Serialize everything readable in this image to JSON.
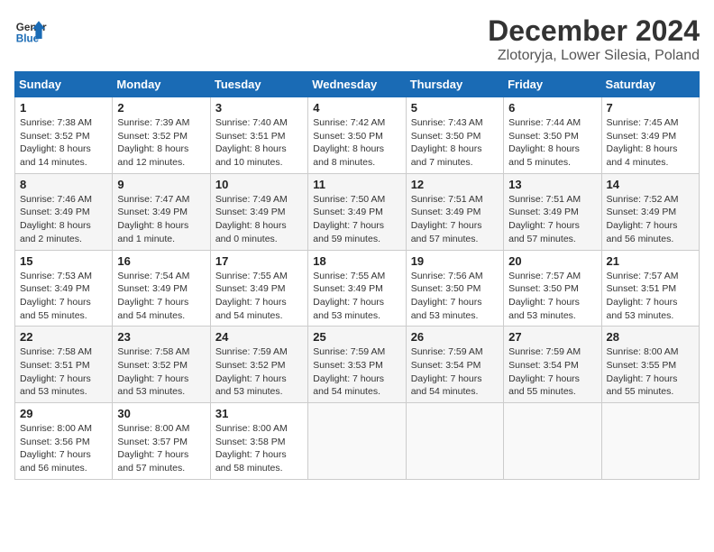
{
  "header": {
    "logo_line1": "General",
    "logo_line2": "Blue",
    "title": "December 2024",
    "subtitle": "Zlotoryja, Lower Silesia, Poland"
  },
  "calendar": {
    "days_of_week": [
      "Sunday",
      "Monday",
      "Tuesday",
      "Wednesday",
      "Thursday",
      "Friday",
      "Saturday"
    ],
    "weeks": [
      [
        {
          "day": "1",
          "info": "Sunrise: 7:38 AM\nSunset: 3:52 PM\nDaylight: 8 hours\nand 14 minutes."
        },
        {
          "day": "2",
          "info": "Sunrise: 7:39 AM\nSunset: 3:52 PM\nDaylight: 8 hours\nand 12 minutes."
        },
        {
          "day": "3",
          "info": "Sunrise: 7:40 AM\nSunset: 3:51 PM\nDaylight: 8 hours\nand 10 minutes."
        },
        {
          "day": "4",
          "info": "Sunrise: 7:42 AM\nSunset: 3:50 PM\nDaylight: 8 hours\nand 8 minutes."
        },
        {
          "day": "5",
          "info": "Sunrise: 7:43 AM\nSunset: 3:50 PM\nDaylight: 8 hours\nand 7 minutes."
        },
        {
          "day": "6",
          "info": "Sunrise: 7:44 AM\nSunset: 3:50 PM\nDaylight: 8 hours\nand 5 minutes."
        },
        {
          "day": "7",
          "info": "Sunrise: 7:45 AM\nSunset: 3:49 PM\nDaylight: 8 hours\nand 4 minutes."
        }
      ],
      [
        {
          "day": "8",
          "info": "Sunrise: 7:46 AM\nSunset: 3:49 PM\nDaylight: 8 hours\nand 2 minutes."
        },
        {
          "day": "9",
          "info": "Sunrise: 7:47 AM\nSunset: 3:49 PM\nDaylight: 8 hours\nand 1 minute."
        },
        {
          "day": "10",
          "info": "Sunrise: 7:49 AM\nSunset: 3:49 PM\nDaylight: 8 hours\nand 0 minutes."
        },
        {
          "day": "11",
          "info": "Sunrise: 7:50 AM\nSunset: 3:49 PM\nDaylight: 7 hours\nand 59 minutes."
        },
        {
          "day": "12",
          "info": "Sunrise: 7:51 AM\nSunset: 3:49 PM\nDaylight: 7 hours\nand 57 minutes."
        },
        {
          "day": "13",
          "info": "Sunrise: 7:51 AM\nSunset: 3:49 PM\nDaylight: 7 hours\nand 57 minutes."
        },
        {
          "day": "14",
          "info": "Sunrise: 7:52 AM\nSunset: 3:49 PM\nDaylight: 7 hours\nand 56 minutes."
        }
      ],
      [
        {
          "day": "15",
          "info": "Sunrise: 7:53 AM\nSunset: 3:49 PM\nDaylight: 7 hours\nand 55 minutes."
        },
        {
          "day": "16",
          "info": "Sunrise: 7:54 AM\nSunset: 3:49 PM\nDaylight: 7 hours\nand 54 minutes."
        },
        {
          "day": "17",
          "info": "Sunrise: 7:55 AM\nSunset: 3:49 PM\nDaylight: 7 hours\nand 54 minutes."
        },
        {
          "day": "18",
          "info": "Sunrise: 7:55 AM\nSunset: 3:49 PM\nDaylight: 7 hours\nand 53 minutes."
        },
        {
          "day": "19",
          "info": "Sunrise: 7:56 AM\nSunset: 3:50 PM\nDaylight: 7 hours\nand 53 minutes."
        },
        {
          "day": "20",
          "info": "Sunrise: 7:57 AM\nSunset: 3:50 PM\nDaylight: 7 hours\nand 53 minutes."
        },
        {
          "day": "21",
          "info": "Sunrise: 7:57 AM\nSunset: 3:51 PM\nDaylight: 7 hours\nand 53 minutes."
        }
      ],
      [
        {
          "day": "22",
          "info": "Sunrise: 7:58 AM\nSunset: 3:51 PM\nDaylight: 7 hours\nand 53 minutes."
        },
        {
          "day": "23",
          "info": "Sunrise: 7:58 AM\nSunset: 3:52 PM\nDaylight: 7 hours\nand 53 minutes."
        },
        {
          "day": "24",
          "info": "Sunrise: 7:59 AM\nSunset: 3:52 PM\nDaylight: 7 hours\nand 53 minutes."
        },
        {
          "day": "25",
          "info": "Sunrise: 7:59 AM\nSunset: 3:53 PM\nDaylight: 7 hours\nand 54 minutes."
        },
        {
          "day": "26",
          "info": "Sunrise: 7:59 AM\nSunset: 3:54 PM\nDaylight: 7 hours\nand 54 minutes."
        },
        {
          "day": "27",
          "info": "Sunrise: 7:59 AM\nSunset: 3:54 PM\nDaylight: 7 hours\nand 55 minutes."
        },
        {
          "day": "28",
          "info": "Sunrise: 8:00 AM\nSunset: 3:55 PM\nDaylight: 7 hours\nand 55 minutes."
        }
      ],
      [
        {
          "day": "29",
          "info": "Sunrise: 8:00 AM\nSunset: 3:56 PM\nDaylight: 7 hours\nand 56 minutes."
        },
        {
          "day": "30",
          "info": "Sunrise: 8:00 AM\nSunset: 3:57 PM\nDaylight: 7 hours\nand 57 minutes."
        },
        {
          "day": "31",
          "info": "Sunrise: 8:00 AM\nSunset: 3:58 PM\nDaylight: 7 hours\nand 58 minutes."
        },
        {
          "day": "",
          "info": ""
        },
        {
          "day": "",
          "info": ""
        },
        {
          "day": "",
          "info": ""
        },
        {
          "day": "",
          "info": ""
        }
      ]
    ]
  }
}
